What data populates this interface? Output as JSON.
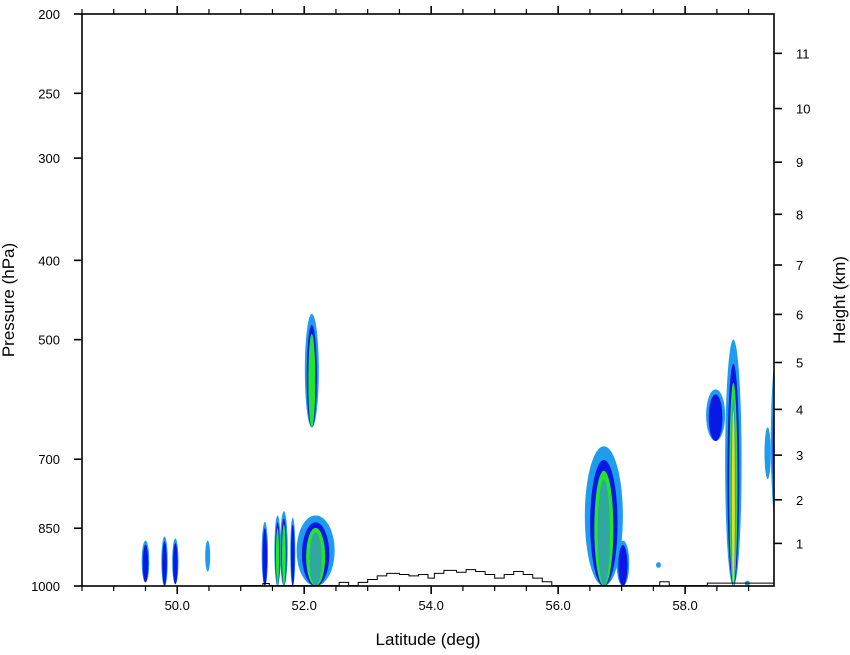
{
  "chart_data": {
    "type": "heatmap",
    "title": "",
    "xlabel": "Latitude (deg)",
    "ylabel": "Pressure (hPa)",
    "ylabel_right": "Height (km)",
    "xlim": [
      48.5,
      59.4
    ],
    "x_ticks": [
      50.0,
      52.0,
      54.0,
      56.0,
      58.0
    ],
    "x_tick_labels": [
      "50.0",
      "52.0",
      "54.0",
      "56.0",
      "58.0"
    ],
    "ylim": [
      1000,
      200
    ],
    "y_scale": "log",
    "y_ticks": [
      200,
      250,
      300,
      400,
      500,
      700,
      850,
      1000
    ],
    "y_tick_labels": [
      "200",
      "250",
      "300",
      "400",
      "500",
      "700",
      "850",
      "1000"
    ],
    "right_ticks_km": [
      1,
      2,
      3,
      4,
      5,
      6,
      7,
      8,
      9,
      10,
      11
    ],
    "right_tick_labels": [
      "1",
      "2",
      "3",
      "4",
      "5",
      "6",
      "7",
      "8",
      "9",
      "10",
      "11"
    ],
    "contour_colors": [
      "#1e9cf0",
      "#0a18e6",
      "#22e62a",
      "#30a8a0",
      "#e8d830"
    ],
    "features": [
      {
        "lat": 49.5,
        "p_top": 880,
        "p_bottom": 990,
        "half_width": 0.06,
        "levels": 2
      },
      {
        "lat": 49.8,
        "p_top": 870,
        "p_bottom": 1000,
        "half_width": 0.05,
        "levels": 2
      },
      {
        "lat": 49.97,
        "p_top": 875,
        "p_bottom": 995,
        "half_width": 0.05,
        "levels": 2
      },
      {
        "lat": 50.48,
        "p_top": 880,
        "p_bottom": 960,
        "half_width": 0.03,
        "levels": 1
      },
      {
        "lat": 51.38,
        "p_top": 835,
        "p_bottom": 1000,
        "half_width": 0.05,
        "levels": 2
      },
      {
        "lat": 51.58,
        "p_top": 820,
        "p_bottom": 1000,
        "half_width": 0.05,
        "levels": 3
      },
      {
        "lat": 51.68,
        "p_top": 810,
        "p_bottom": 1000,
        "half_width": 0.06,
        "levels": 3
      },
      {
        "lat": 51.82,
        "p_top": 825,
        "p_bottom": 1000,
        "half_width": 0.04,
        "levels": 2
      },
      {
        "lat": 52.12,
        "p_top": 465,
        "p_bottom": 640,
        "half_width": 0.11,
        "levels": 3
      },
      {
        "lat": 52.18,
        "p_top": 820,
        "p_bottom": 1000,
        "half_width": 0.3,
        "levels": 4
      },
      {
        "lat": 56.72,
        "p_top": 675,
        "p_bottom": 1000,
        "half_width": 0.3,
        "levels": 4
      },
      {
        "lat": 57.02,
        "p_top": 880,
        "p_bottom": 1000,
        "half_width": 0.1,
        "levels": 2
      },
      {
        "lat": 57.58,
        "p_top": 935,
        "p_bottom": 950,
        "half_width": 0.02,
        "levels": 1
      },
      {
        "lat": 58.48,
        "p_top": 575,
        "p_bottom": 665,
        "half_width": 0.15,
        "levels": 2
      },
      {
        "lat": 58.76,
        "p_top": 500,
        "p_bottom": 1000,
        "half_width": 0.13,
        "levels": 5
      },
      {
        "lat": 58.98,
        "p_top": 985,
        "p_bottom": 1000,
        "half_width": 0.03,
        "levels": 1
      },
      {
        "lat": 59.3,
        "p_top": 640,
        "p_bottom": 740,
        "half_width": 0.05,
        "levels": 1
      },
      {
        "lat": 59.45,
        "p_top": 520,
        "p_bottom": 850,
        "half_width": 0.1,
        "levels": 2
      }
    ],
    "terrain": [
      {
        "lat": 51.0,
        "p": 999
      },
      {
        "lat": 51.25,
        "p": 999
      },
      {
        "lat": 51.35,
        "p": 993
      },
      {
        "lat": 51.45,
        "p": 999
      },
      {
        "lat": 52.45,
        "p": 999
      },
      {
        "lat": 52.55,
        "p": 990
      },
      {
        "lat": 52.7,
        "p": 999
      },
      {
        "lat": 52.85,
        "p": 990
      },
      {
        "lat": 53.0,
        "p": 982
      },
      {
        "lat": 53.15,
        "p": 972
      },
      {
        "lat": 53.3,
        "p": 965
      },
      {
        "lat": 53.5,
        "p": 968
      },
      {
        "lat": 53.65,
        "p": 972
      },
      {
        "lat": 53.8,
        "p": 968
      },
      {
        "lat": 53.95,
        "p": 978
      },
      {
        "lat": 54.05,
        "p": 965
      },
      {
        "lat": 54.2,
        "p": 957
      },
      {
        "lat": 54.4,
        "p": 962
      },
      {
        "lat": 54.55,
        "p": 955
      },
      {
        "lat": 54.7,
        "p": 960
      },
      {
        "lat": 54.85,
        "p": 968
      },
      {
        "lat": 55.0,
        "p": 978
      },
      {
        "lat": 55.15,
        "p": 968
      },
      {
        "lat": 55.3,
        "p": 960
      },
      {
        "lat": 55.45,
        "p": 968
      },
      {
        "lat": 55.6,
        "p": 978
      },
      {
        "lat": 55.75,
        "p": 988
      },
      {
        "lat": 55.9,
        "p": 999
      },
      {
        "lat": 57.5,
        "p": 999
      },
      {
        "lat": 57.6,
        "p": 988
      },
      {
        "lat": 57.75,
        "p": 999
      },
      {
        "lat": 58.3,
        "p": 999
      },
      {
        "lat": 58.35,
        "p": 992
      },
      {
        "lat": 59.4,
        "p": 992
      }
    ]
  }
}
